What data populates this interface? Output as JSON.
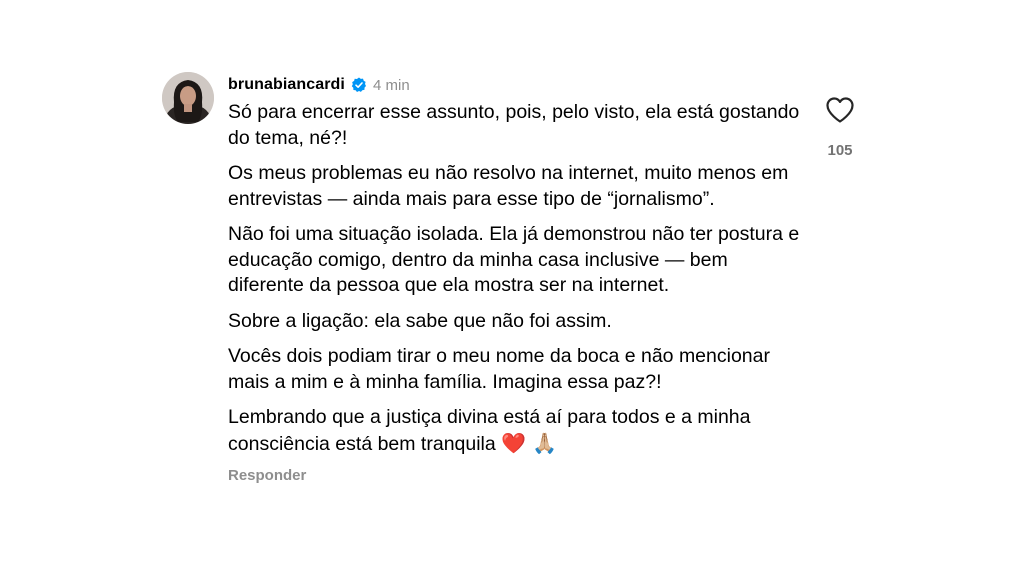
{
  "comment": {
    "username": "brunabiancardi",
    "time": "4 min",
    "paragraphs": [
      "Só para encerrar esse assunto, pois, pelo visto, ela está gostando do tema, né?!",
      "Os meus problemas eu não resolvo na internet, muito menos em entrevistas — ainda mais para esse tipo de “jornalismo”.",
      "Não foi uma situação isolada. Ela já demonstrou não ter postura e educação comigo, dentro da minha casa inclusive — bem diferente da pessoa que ela mostra ser na internet.",
      "Sobre a ligação: ela sabe que não foi assim.",
      "Vocês dois podiam tirar o meu nome da boca e não mencionar mais a mim e à minha família. Imagina essa paz?!",
      "Lembrando que a justiça divina está aí para todos e a minha consciência está bem tranquila"
    ],
    "emojis": "❤️ 🙏🏼",
    "reply_label": "Responder",
    "like_count": "105"
  },
  "icons": {
    "verified": "verified-badge-icon",
    "like": "heart-outline-icon"
  },
  "colors": {
    "verified_blue": "#0095f6",
    "muted_text": "#8e8e8e",
    "text": "#000000"
  }
}
